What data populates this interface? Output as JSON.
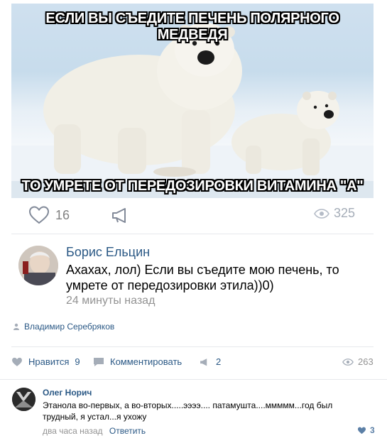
{
  "meme": {
    "caption_top": "ЕСЛИ ВЫ СЪЕДИТЕ ПЕЧЕНЬ ПОЛЯРНОГО МЕДВЕДЯ",
    "caption_bottom": "ТО УМРЕТЕ ОТ ПЕРЕДОЗИРОВКИ ВИТАМИНА \"А\""
  },
  "post_actions": {
    "likes": "16",
    "views": "325",
    "heart_icon": "heart-icon",
    "share_icon": "megaphone-icon",
    "views_icon": "eye-icon"
  },
  "comment": {
    "author": "Борис Ельцин",
    "text": "Ахахах, лол) Если вы съедите мою печень, то умрете от передозировки этила))0)",
    "time": "24 минуты назад",
    "reposted_by": "Владимир Серебряков"
  },
  "repost_actions": {
    "like_label": "Нравится",
    "like_count": "9",
    "comment_label": "Комментировать",
    "share_count": "2",
    "views": "263"
  },
  "reply": {
    "author": "Олег Норич",
    "text": "Этанола во-первых, а во-вторых.....ээээ.... патамушта....ммммм...год был трудный, я устал...я ухожу",
    "time": "два часа назад",
    "reply_label": "Ответить",
    "likes": "3"
  },
  "colors": {
    "link": "#2a5885",
    "muted": "#939393",
    "divider": "#e7e8ec"
  }
}
